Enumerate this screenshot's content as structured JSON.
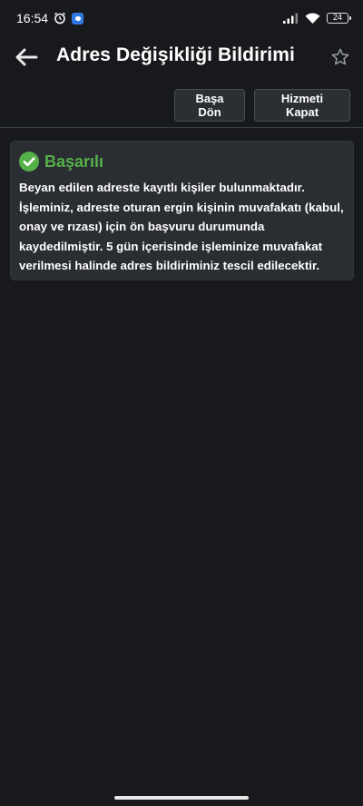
{
  "status_bar": {
    "time": "16:54",
    "battery": "24"
  },
  "header": {
    "title": "Adres Değişikliği Bildirimi"
  },
  "actions": {
    "home_label": "Başa Dön",
    "close_label": "Hizmeti Kapat"
  },
  "alert": {
    "title": "Başarılı",
    "message": "Beyan edilen adreste kayıtlı kişiler bulunmaktadır. İşleminiz, adreste oturan ergin kişinin muvafakatı (kabul, onay ve rızası) için ön başvuru durumunda kaydedilmiştir. 5 gün içerisinde işleminize muvafakat verilmesi halinde adres bildiriminiz tescil edilecektir.",
    "status_color": "#56b04a"
  },
  "icons": {
    "back": "arrow-left-icon",
    "favorite": "star-outline-icon",
    "success": "check-circle-icon"
  }
}
